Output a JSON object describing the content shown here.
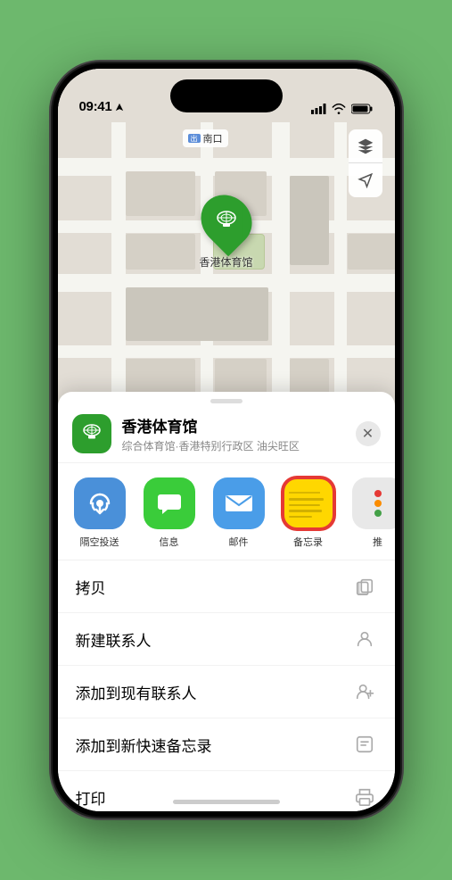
{
  "status_bar": {
    "time": "09:41",
    "location_arrow": true
  },
  "map": {
    "location_label": "南口",
    "controls": [
      "map-layers",
      "location-arrow"
    ]
  },
  "location_pin": {
    "name": "香港体育馆"
  },
  "bottom_sheet": {
    "venue_name": "香港体育馆",
    "venue_sub": "综合体育馆·香港特别行政区 油尖旺区",
    "close_label": "×"
  },
  "share_items": [
    {
      "id": "airdrop",
      "label": "隔空投送",
      "type": "airdrop"
    },
    {
      "id": "message",
      "label": "信息",
      "type": "message"
    },
    {
      "id": "mail",
      "label": "邮件",
      "type": "mail"
    },
    {
      "id": "notes",
      "label": "备忘录",
      "type": "notes"
    },
    {
      "id": "more",
      "label": "推",
      "type": "more"
    }
  ],
  "action_items": [
    {
      "id": "copy",
      "label": "拷贝",
      "icon": "copy"
    },
    {
      "id": "new-contact",
      "label": "新建联系人",
      "icon": "person"
    },
    {
      "id": "add-contact",
      "label": "添加到现有联系人",
      "icon": "person-add"
    },
    {
      "id": "quick-note",
      "label": "添加到新快速备忘录",
      "icon": "note"
    },
    {
      "id": "print",
      "label": "打印",
      "icon": "printer"
    }
  ]
}
